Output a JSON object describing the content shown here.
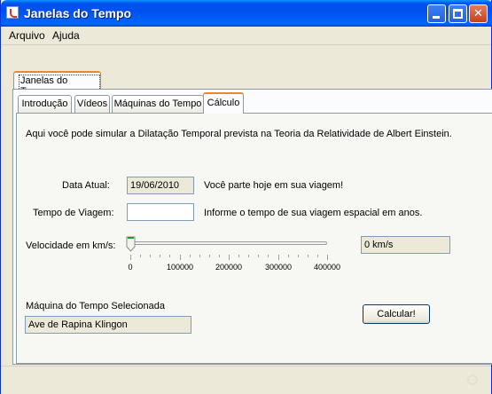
{
  "window": {
    "title": "Janelas do Tempo"
  },
  "menu": [
    "Arquivo",
    "Ajuda"
  ],
  "outer_tab": {
    "label": "Janelas do Tempo"
  },
  "tabs": [
    {
      "label": "Introdução",
      "selected": false
    },
    {
      "label": "Vídeos",
      "selected": false
    },
    {
      "label": "Máquinas do Tempo",
      "selected": false
    },
    {
      "label": "Cálculo",
      "selected": true
    }
  ],
  "content": {
    "intro": "Aqui você pode simular a Dilatação Temporal prevista na Teoria da Relatividade de Albert Einstein.",
    "current_date": {
      "label": "Data Atual:",
      "value": "19/06/2010",
      "hint": "Você parte hoje em sua viagem!"
    },
    "travel_time": {
      "label": "Tempo de Viagem:",
      "value": "",
      "hint": "Informe o tempo de sua viagem espacial em anos."
    },
    "speed": {
      "label": "Velocidade em km/s:",
      "value": 0,
      "min": 0,
      "max": 400000,
      "tick_labels": [
        "0",
        "100000",
        "200000",
        "300000",
        "400000"
      ],
      "display": "0 km/s"
    },
    "machine": {
      "label": "Máquina do Tempo Selecionada",
      "value": "Ave de Rapina Klingon"
    },
    "calculate_button": "Calcular!"
  }
}
